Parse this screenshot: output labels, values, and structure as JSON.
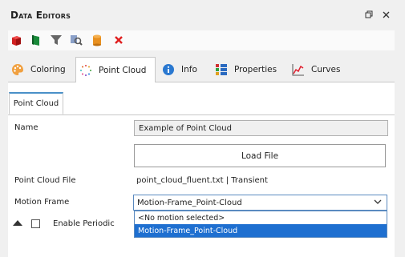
{
  "window": {
    "title": "Data Editors"
  },
  "tabs": [
    {
      "label": "Coloring"
    },
    {
      "label": "Point Cloud"
    },
    {
      "label": "Info"
    },
    {
      "label": "Properties"
    },
    {
      "label": "Curves"
    }
  ],
  "subtab": {
    "label": "Point Cloud"
  },
  "form": {
    "name_label": "Name",
    "name_value": "Example of Point Cloud",
    "load_file_label": "Load File",
    "file_label": "Point Cloud File",
    "file_value": "point_cloud_fluent.txt | Transient",
    "motion_label": "Motion Frame",
    "motion_value": "Motion-Frame_Point-Cloud",
    "periodic_label": "Enable Periodic"
  },
  "dropdown": {
    "options": [
      "<No motion selected>",
      "Motion-Frame_Point-Cloud"
    ]
  },
  "colors": {
    "accent": "#1e6fd0",
    "select_border": "#5a8ac0"
  }
}
